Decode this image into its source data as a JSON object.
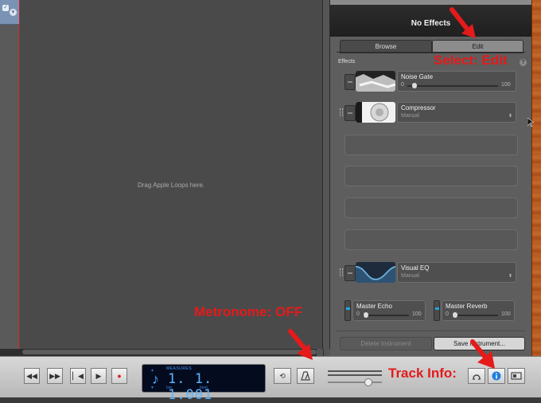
{
  "track_header": {
    "icon": "✓"
  },
  "loop_area": {
    "hint": "Drag Apple Loops here."
  },
  "panel": {
    "title": "No Effects",
    "tabs": [
      {
        "label": "Browse",
        "selected": false
      },
      {
        "label": "Edit",
        "selected": true
      }
    ],
    "effects_label": "Effects",
    "help": "?",
    "effects": [
      {
        "name": "Noise Gate",
        "min": "0",
        "max": "100",
        "value": 0.08
      },
      {
        "name": "Compressor",
        "preset": "Manual"
      },
      {
        "name": "Visual EQ",
        "preset": "Manual"
      }
    ],
    "sends": [
      {
        "name": "Master Echo",
        "min": "0",
        "max": "100",
        "value": 0.07
      },
      {
        "name": "Master Reverb",
        "min": "0",
        "max": "100",
        "value": 0.07
      }
    ],
    "delete_button": "Delete Instrument",
    "save_button": "Save Instrument..."
  },
  "transport": {
    "lcd_mode": "MEASURES",
    "lcd_value": "1.  1.  1.001",
    "lcd_bar": "bar",
    "lcd_beat": "beat",
    "buttons": [
      "◀◀",
      "▶▶",
      "▏◀",
      "▶",
      "●"
    ]
  },
  "annotations": {
    "select_edit": "Select: Edit",
    "metronome": "Metronome: OFF",
    "track_info": "Track Info:"
  },
  "colors": {
    "annotation": "#e51a1a",
    "lcd_text": "#5bb4ff",
    "info_button": "#1e7fe0"
  }
}
